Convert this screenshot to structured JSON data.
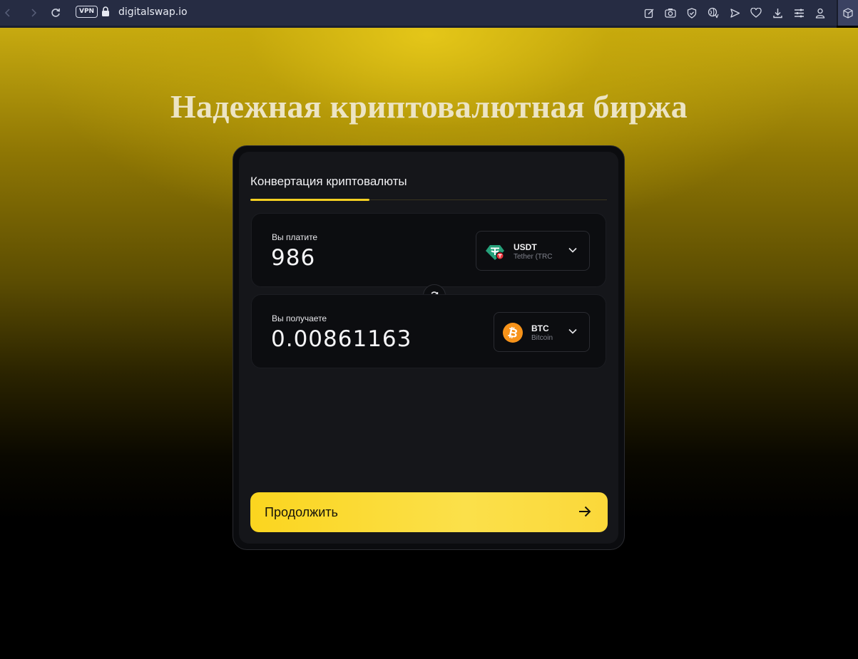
{
  "browser": {
    "vpn_label": "VPN",
    "url": "digitalswap.io",
    "icons": [
      "back-icon",
      "forward-icon",
      "reload-icon",
      "lock-icon",
      "edit-icon",
      "camera-icon",
      "shield-icon",
      "translate-icon",
      "send-icon",
      "heart-icon",
      "download-icon",
      "menu-icon",
      "profile-icon",
      "extension-icon"
    ]
  },
  "hero": {
    "title": "Надежная криптовалютная биржа"
  },
  "converter": {
    "tab_label": "Конвертация криптовалюты",
    "pay": {
      "label": "Вы платите",
      "amount": "986",
      "coin_code": "USDT",
      "coin_name": "Tether (TRC"
    },
    "receive": {
      "label": "Вы получаете",
      "amount": "0.00861163",
      "coin_code": "BTC",
      "coin_name": "Bitcoin"
    },
    "continue_label": "Продолжить"
  },
  "colors": {
    "accent": "#f4cf22",
    "button": "#fbd51f",
    "usdt": "#26a17b",
    "btc": "#f7931a"
  }
}
